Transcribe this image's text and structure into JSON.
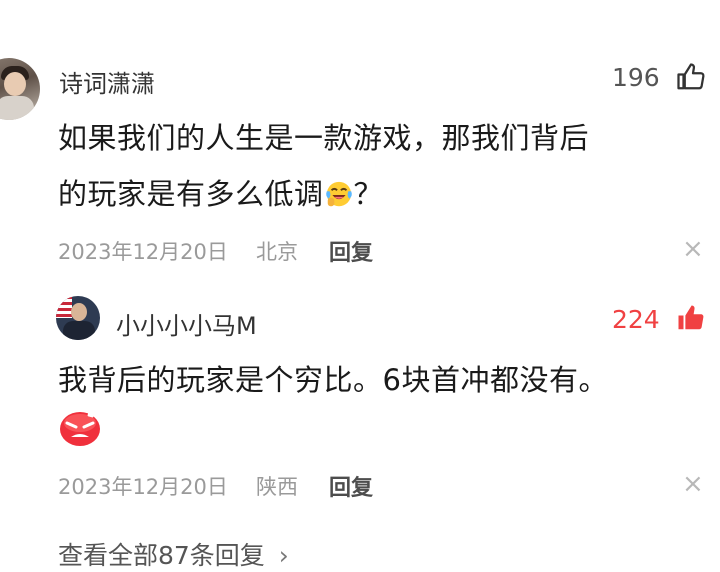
{
  "comment": {
    "username": "诗词潇潇",
    "like_count": "196",
    "text_line1": "如果我们的人生是一款游戏，那我们背后",
    "text_line2_before_emoji": "的玩家是有多么低调",
    "text_line2_after_emoji": "？",
    "emoji": "crying-laughing-emoji",
    "date": "2023年12月20日",
    "location": "北京",
    "reply_label": "回复",
    "close_symbol": "×"
  },
  "reply": {
    "username": "小小小小马M",
    "like_count": "224",
    "liked": true,
    "text": "我背后的玩家是个穷比。6块首冲都没有。",
    "emoji": "angry-red-face-emoji",
    "date": "2023年12月20日",
    "location": "陕西",
    "reply_label": "回复",
    "close_symbol": "×"
  },
  "view_all": {
    "label": "查看全部87条回复",
    "chevron": "›"
  },
  "colors": {
    "liked_red": "#f04142",
    "meta_gray": "#9a9a9a",
    "text": "#1a1a1a"
  }
}
